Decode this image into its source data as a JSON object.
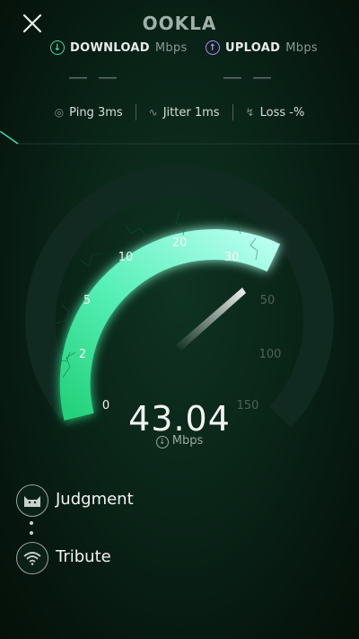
{
  "app": {
    "logo_text": "OOKLA",
    "close_icon": "close-icon"
  },
  "download": {
    "label": "DOWNLOAD",
    "unit": "Mbps",
    "value": "— —",
    "icon": "download-arrow-icon",
    "color": "#3fdcb0"
  },
  "upload": {
    "label": "UPLOAD",
    "unit": "Mbps",
    "value": "— —",
    "icon": "upload-arrow-icon",
    "color": "#b48bff"
  },
  "stats": {
    "ping": "Ping  3ms",
    "jitter": "Jitter  1ms",
    "loss": "Loss  -%"
  },
  "gauge": {
    "ticks": [
      "0",
      "2",
      "5",
      "10",
      "20",
      "30",
      "50",
      "100",
      "150"
    ],
    "current_speed": "43.04",
    "unit": "Mbps",
    "max_filled_tick": "30",
    "accent": "#36e6b0"
  },
  "servers": {
    "host_name": "Judgment",
    "host_icon": "server-avatar-icon",
    "network_name": "Tribute",
    "network_icon": "wifi-icon"
  }
}
